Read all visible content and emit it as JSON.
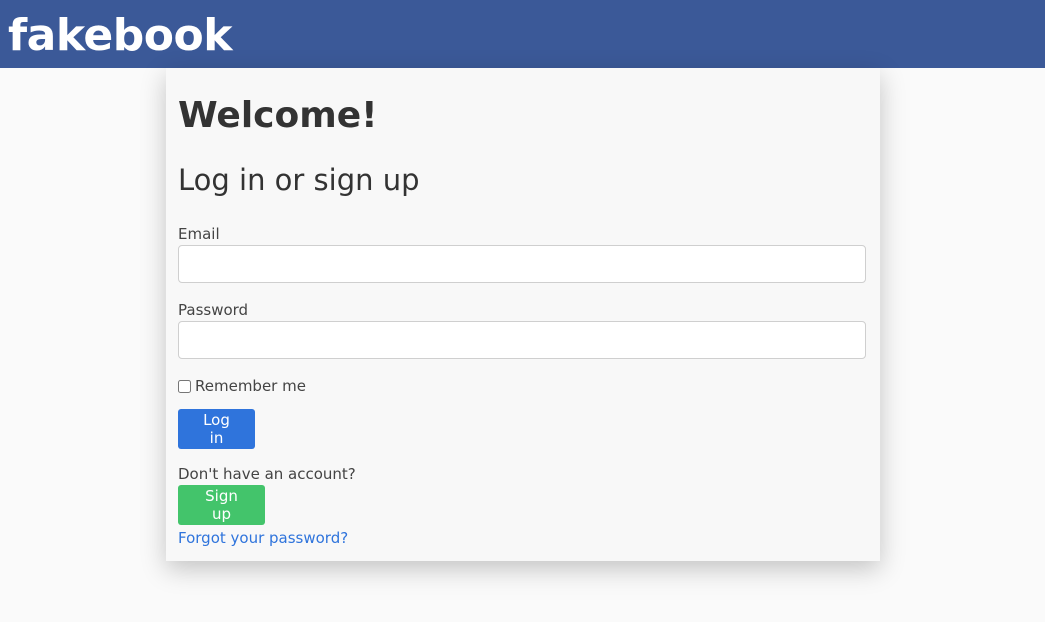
{
  "header": {
    "brand": "fakebook"
  },
  "login_card": {
    "welcome": "Welcome!",
    "subtitle": "Log in or sign up",
    "email_label": "Email",
    "email_value": "",
    "password_label": "Password",
    "password_value": "",
    "remember_label": "Remember me",
    "login_button": "Log in",
    "no_account_text": "Don't have an account?",
    "signup_button": "Sign up",
    "forgot_link": "Forgot your password?"
  },
  "colors": {
    "header_bg": "#3b5998",
    "login_button": "#2f74dc",
    "signup_button": "#43c46b",
    "link": "#2f74dc"
  }
}
